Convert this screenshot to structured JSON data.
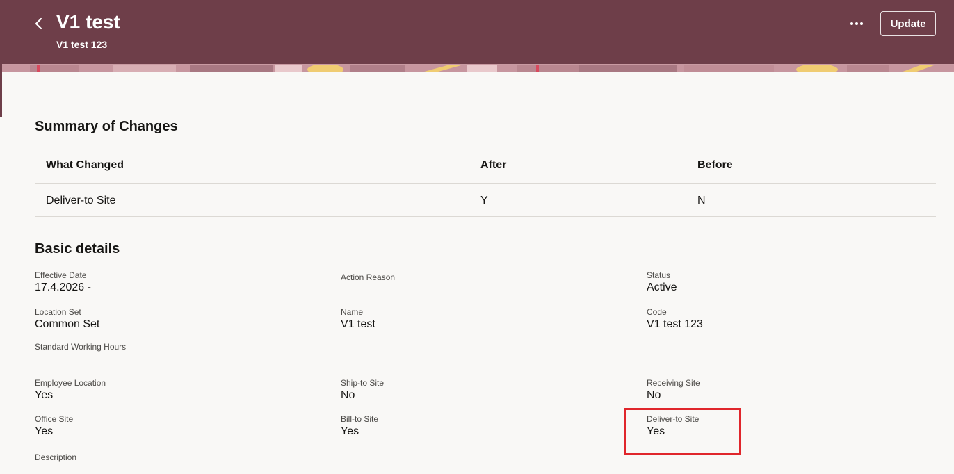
{
  "header": {
    "title": "V1 test",
    "subtitle": "V1 test 123",
    "update_label": "Update",
    "back_icon": "chevron-left-icon",
    "more_icon": "more-horizontal-icon"
  },
  "summary": {
    "title": "Summary of Changes",
    "columns": [
      "What Changed",
      "After",
      "Before"
    ],
    "rows": [
      [
        "Deliver-to Site",
        "Y",
        "N"
      ]
    ]
  },
  "basic": {
    "title": "Basic details",
    "fields": {
      "effective_date": {
        "label": "Effective Date",
        "value": "17.4.2026 -"
      },
      "action_reason": {
        "label": "Action Reason",
        "value": ""
      },
      "status": {
        "label": "Status",
        "value": "Active"
      },
      "location_set": {
        "label": "Location Set",
        "value": "Common Set"
      },
      "name": {
        "label": "Name",
        "value": "V1 test"
      },
      "code": {
        "label": "Code",
        "value": "V1 test 123"
      },
      "standard_hours": {
        "label": "Standard Working Hours",
        "value": ""
      },
      "employee_location": {
        "label": "Employee Location",
        "value": "Yes"
      },
      "ship_to": {
        "label": "Ship-to Site",
        "value": "No"
      },
      "receiving": {
        "label": "Receiving Site",
        "value": "No"
      },
      "office": {
        "label": "Office Site",
        "value": "Yes"
      },
      "bill_to": {
        "label": "Bill-to Site",
        "value": "Yes"
      },
      "deliver_to": {
        "label": "Deliver-to Site",
        "value": "Yes"
      },
      "description": {
        "label": "Description",
        "value": ""
      }
    }
  },
  "colors": {
    "header_bg": "#6e3e49",
    "highlight": "#e0262b"
  }
}
